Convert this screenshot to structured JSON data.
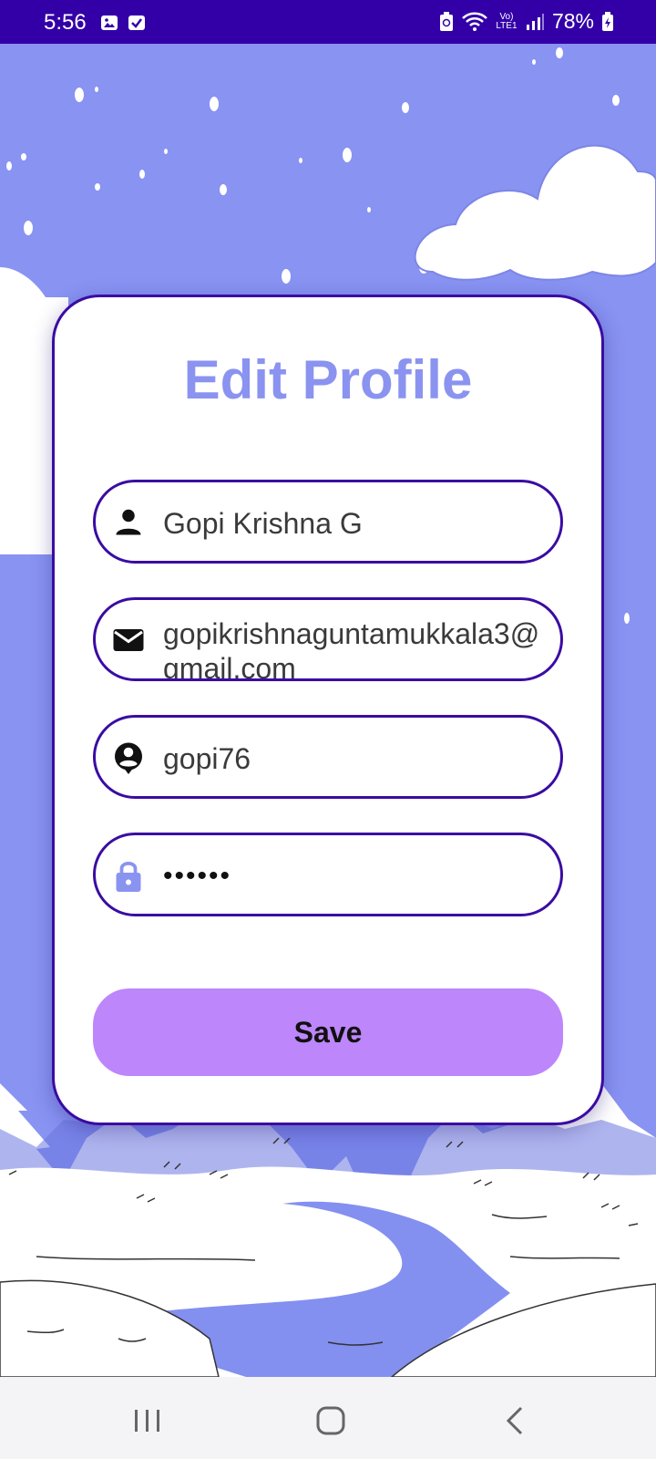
{
  "status_bar": {
    "time": "5:56",
    "battery": "78%",
    "signal_label": "Vo) LTE1"
  },
  "form": {
    "title": "Edit Profile",
    "fields": [
      {
        "name": "full-name",
        "icon": "person-icon",
        "value": "Gopi Krishna G"
      },
      {
        "name": "email",
        "icon": "mail-icon",
        "value": "gopikrishnaguntamukkala3@gmail.com"
      },
      {
        "name": "username",
        "icon": "account-circle-icon",
        "value": "gopi76"
      },
      {
        "name": "password",
        "icon": "lock-icon",
        "value": "••••••"
      }
    ],
    "save_label": "Save"
  },
  "colors": {
    "accent": "#8b93f0",
    "border": "#3a0ca3",
    "button": "#bd86fb",
    "status_bar": "#3300a8",
    "background": "#8893f2"
  }
}
